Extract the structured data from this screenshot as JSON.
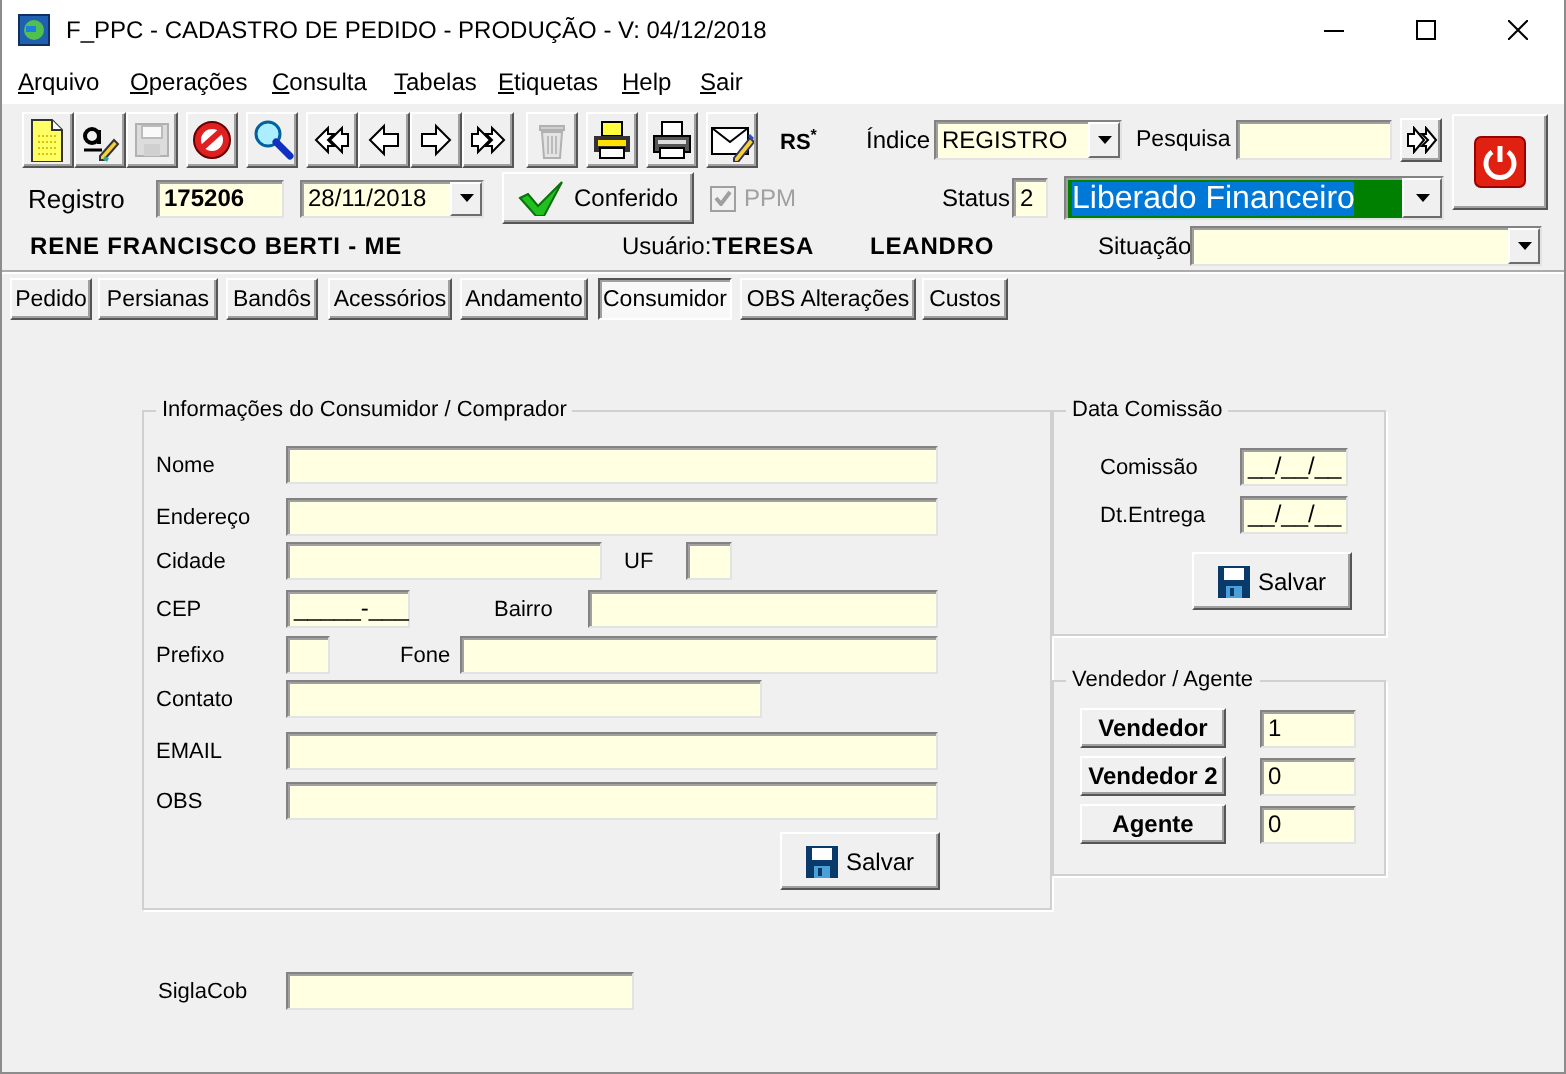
{
  "window": {
    "title": "F_PPC - CADASTRO DE PEDIDO - PRODUÇÃO - V: 04/12/2018"
  },
  "menu": [
    {
      "label": "Arquivo"
    },
    {
      "label": "Operações"
    },
    {
      "label": "Consulta"
    },
    {
      "label": "Tabelas"
    },
    {
      "label": "Etiquetas"
    },
    {
      "label": "Help"
    },
    {
      "label": "Sair"
    }
  ],
  "toolbar": [
    {
      "kind": "new",
      "disabled": false
    },
    {
      "kind": "edit",
      "disabled": false
    },
    {
      "kind": "save",
      "disabled": true
    },
    {
      "kind": "cancel",
      "disabled": false
    },
    {
      "kind": "search",
      "disabled": false
    },
    {
      "kind": "first",
      "disabled": false
    },
    {
      "kind": "previous",
      "disabled": false
    },
    {
      "kind": "next",
      "disabled": false
    },
    {
      "kind": "last",
      "disabled": false
    },
    {
      "kind": "delete",
      "disabled": true
    },
    {
      "kind": "print_preview",
      "disabled": false
    },
    {
      "kind": "print",
      "disabled": false
    },
    {
      "kind": "email",
      "disabled": false
    }
  ],
  "rs_mark": "RS$^{*}$",
  "indice": {
    "label": "Índice",
    "value": "REGISTRO"
  },
  "pesquisa": {
    "label": "Pesquisa"
  },
  "registro": {
    "label": "Registro",
    "value": "175206",
    "date": "28/11/2018"
  },
  "conferido_button": "Conferido",
  "ppm": {
    "label": "PPM",
    "checked": true,
    "disabled": true
  },
  "status": {
    "label": "Status",
    "code": "2",
    "value": "Liberado Financeiro",
    "highlighted": true
  },
  "customer_name": "RENE FRANCISCO BERTI - ME",
  "user": {
    "label": "Usuário:",
    "name": "TERESA"
  },
  "seller_name": "LEANDRO",
  "situacao": {
    "label": "Situação"
  },
  "tabs": [
    {
      "label": "Pedido",
      "selected": false
    },
    {
      "label": "Persianas",
      "selected": false
    },
    {
      "label": "Bandôs",
      "selected": false
    },
    {
      "label": "Acessórios",
      "selected": false
    },
    {
      "label": "Andamento",
      "selected": false
    },
    {
      "label": "Consumidor",
      "selected": true
    },
    {
      "label": "OBS Alterações",
      "selected": false
    },
    {
      "label": "Custos",
      "selected": false
    }
  ],
  "consumer": {
    "title": "Informações do Consumidor / Comprador",
    "rows": [
      [
        {
          "label": "Nome"
        }
      ],
      [
        {
          "label": "Endereço"
        }
      ],
      [
        {
          "label": "Cidade"
        },
        {
          "label": "UF"
        }
      ],
      [
        {
          "label": "CEP",
          "value": "_____-___"
        },
        {
          "label": "Bairro"
        }
      ],
      [
        {
          "label": "Prefixo"
        },
        {
          "label": "Fone"
        }
      ],
      [
        {
          "label": "Contato"
        }
      ],
      [
        {
          "label": "EMAIL"
        }
      ],
      [
        {
          "label": "OBS"
        }
      ]
    ],
    "save_button": "Salvar"
  },
  "commission": {
    "title": "Data Comissão",
    "fields": [
      {
        "label": "Comissão",
        "value": "__/__/__"
      },
      {
        "label": "Dt.Entrega",
        "value": "__/__/__"
      }
    ],
    "save_button": "Salvar"
  },
  "agents": {
    "title": "Vendedor / Agente",
    "rows": [
      {
        "button": "Vendedor",
        "value": "1"
      },
      {
        "button": "Vendedor 2",
        "value": "0"
      },
      {
        "button": "Agente",
        "value": "0"
      }
    ]
  },
  "sigla_cob": {
    "label": "SiglaCob"
  }
}
